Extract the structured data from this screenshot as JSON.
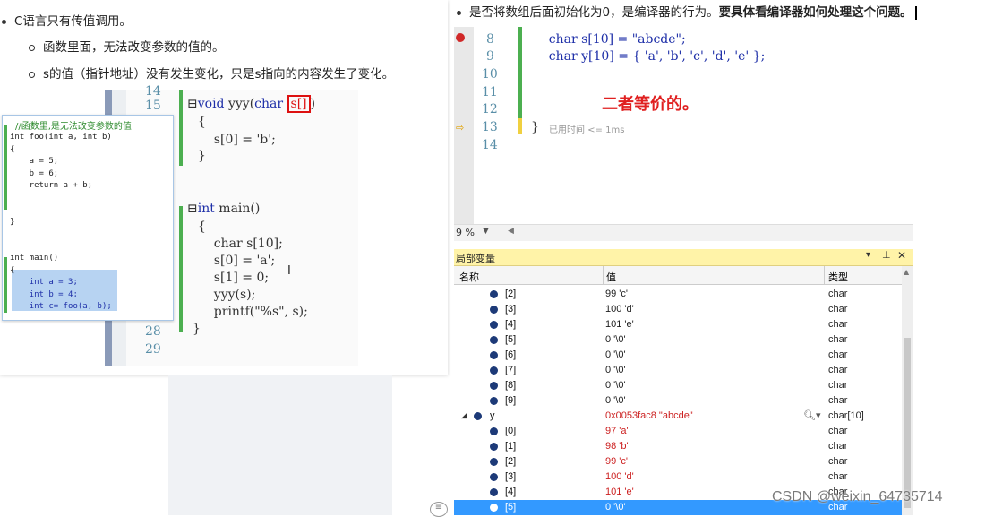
{
  "notes": {
    "item1": "C语言只有传值调用。",
    "item1a": "函数里面，无法改变参数的值的。",
    "item1b": "s的值（指针地址）没有发生变化，只是s指向的内容发生了变化。",
    "item2_plain": "是否将数组后面初始化为0，是编译器的行为。",
    "item2_bold": "要具体看编译器如何处理这个问题。"
  },
  "code_left": {
    "lines": [
      {
        "num": "15",
        "text": "void yyy(char s[])"
      },
      {
        "num": "",
        "text": "{"
      },
      {
        "num": "",
        "text": "    s[0] = 'b';"
      },
      {
        "num": "",
        "text": "}"
      },
      {
        "num": "",
        "text": "int main()"
      },
      {
        "num": "",
        "text": "{"
      },
      {
        "num": "",
        "text": "    char s[10];"
      },
      {
        "num": "",
        "text": "    s[0] = 'a';"
      },
      {
        "num": "",
        "text": "    s[1] = 0;"
      },
      {
        "num": "",
        "text": "    yyy(s);"
      },
      {
        "num": "",
        "text": "    printf(\"%s\", s);"
      },
      {
        "num": "28",
        "text": "}"
      },
      {
        "num": "29",
        "text": ""
      }
    ],
    "top_num": "14"
  },
  "popup_code": {
    "comment": "//函数里,是无法改变参数的值",
    "lines": [
      "int foo(int a, int b)",
      "{",
      "    a = 5;",
      "    b = 6;",
      "    return a + b;",
      "",
      "",
      "}",
      "",
      "",
      "int main()",
      "{",
      "    int a = 3;",
      "    int b = 4;",
      "    int c= foo(a, b);"
    ]
  },
  "code_right": {
    "lines": [
      {
        "num": "8",
        "text": "    char s[10] = \"abcde\";"
      },
      {
        "num": "9",
        "text": "    char y[10] = { 'a', 'b', 'c', 'd', 'e' };"
      },
      {
        "num": "10",
        "text": ""
      },
      {
        "num": "11",
        "text": ""
      },
      {
        "num": "12",
        "text": ""
      },
      {
        "num": "13",
        "text": "}"
      },
      {
        "num": "14",
        "text": ""
      }
    ],
    "annotation": "二者等价的。",
    "elapsed": "已用时间 <= 1ms",
    "zoom": "9 %"
  },
  "locals": {
    "title": "局部变量",
    "col_name": "名称",
    "col_value": "值",
    "col_type": "类型",
    "rows": [
      {
        "name": "[2]",
        "value": "99 'c'",
        "type": "char"
      },
      {
        "name": "[3]",
        "value": "100 'd'",
        "type": "char"
      },
      {
        "name": "[4]",
        "value": "101 'e'",
        "type": "char"
      },
      {
        "name": "[5]",
        "value": "0 '\\0'",
        "type": "char"
      },
      {
        "name": "[6]",
        "value": "0 '\\0'",
        "type": "char"
      },
      {
        "name": "[7]",
        "value": "0 '\\0'",
        "type": "char"
      },
      {
        "name": "[8]",
        "value": "0 '\\0'",
        "type": "char"
      },
      {
        "name": "[9]",
        "value": "0 '\\0'",
        "type": "char"
      },
      {
        "name": "y",
        "value": "0x0053fac8 \"abcde\"",
        "type": "char[10]"
      },
      {
        "name": "[0]",
        "value": "97 'a'",
        "type": "char"
      },
      {
        "name": "[1]",
        "value": "98 'b'",
        "type": "char"
      },
      {
        "name": "[2]",
        "value": "99 'c'",
        "type": "char"
      },
      {
        "name": "[3]",
        "value": "100 'd'",
        "type": "char"
      },
      {
        "name": "[4]",
        "value": "101 'e'",
        "type": "char"
      },
      {
        "name": "[5]",
        "value": "0 '\\0'",
        "type": "char"
      }
    ]
  },
  "watermark": "CSDN @weixin_64735714",
  "colors": {
    "accent": "#3399ff",
    "keyword": "#1e2fa8",
    "annotation": "#e02020",
    "green_bar": "#4caf50"
  }
}
